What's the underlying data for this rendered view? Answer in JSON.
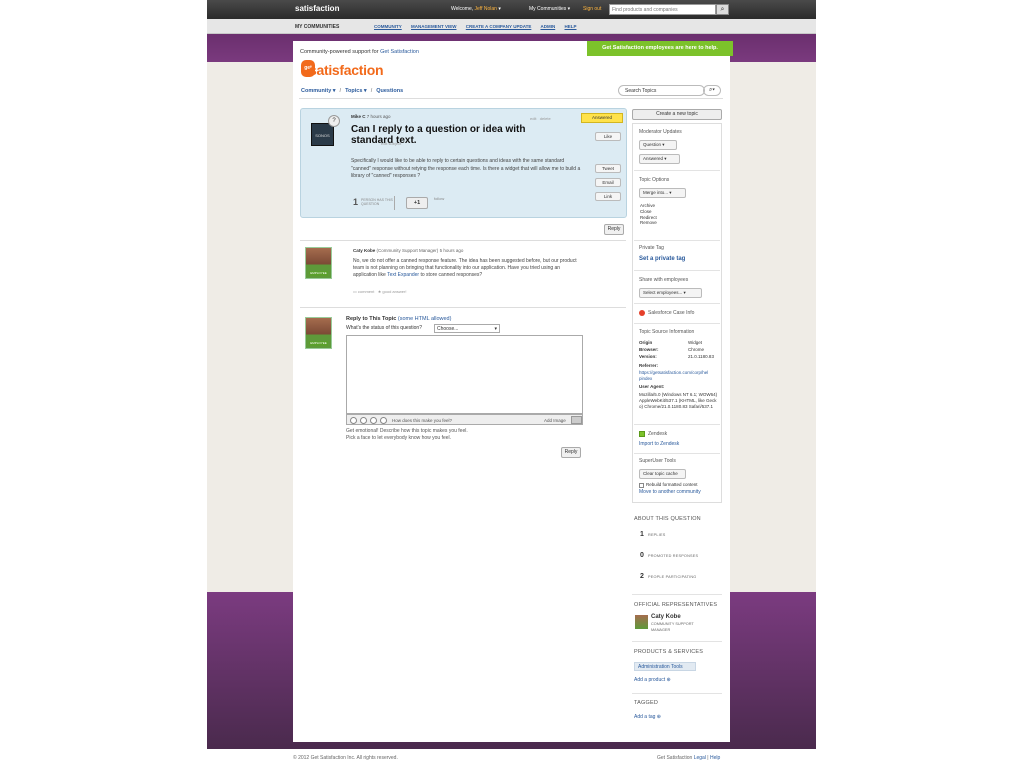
{
  "topbar": {
    "logo": "satisfaction",
    "welcome_prefix": "Welcome,",
    "user": "Jeff Nolan",
    "my_communities": "My Communities",
    "sign_out": "Sign out",
    "search_placeholder": "Find products and companies"
  },
  "subnav": {
    "title": "MY COMMUNITIES",
    "links": [
      "COMMUNITY",
      "MANAGEMENT VIEW",
      "CREATE A COMPANY UPDATE",
      "ADMIN",
      "HELP"
    ]
  },
  "header": {
    "tagline_prefix": "Community-powered support for",
    "tagline_link": "Get Satisfaction",
    "logo_badge": "get",
    "logo_word": "satisfaction",
    "employees_banner": "Get Satisfaction employees are here to help."
  },
  "breadcrumb": [
    "Community",
    "Topics",
    "Questions"
  ],
  "topic_search": {
    "placeholder": "Search Topics"
  },
  "question": {
    "avatar_text": "SONOS",
    "author": "Mike C",
    "time": "7 hours ago",
    "edit": "edit",
    "delete": "delete",
    "title": "Can I reply to a question or idea with standard text.",
    "edit_subject": "edit subject",
    "body": "Specifically I would like to be able to reply to certain questions and ideas with the same standard \"canned\" response without retying the response each time. Is there a widget that will allow me to build a library of \"canned\" responses ?",
    "status": "Answered",
    "like": "Like",
    "tweet": "Tweet",
    "email": "Email",
    "link": "Link",
    "count": "1",
    "count_label": "PERSON HAS THIS QUESTION",
    "plus_one": "+1",
    "follow": "follow"
  },
  "reply_button": "Reply",
  "reply": {
    "author": "Caty Kobe",
    "role": "(Community Support Manager)",
    "time": "5 hours ago",
    "body_pre": "No, we do not offer a canned response feature. The idea has been suggested before, but our product team is not planning on bringing that functionality into our application. Have you tried using an application like",
    "body_link": "Text Expander",
    "body_post": "to store canned responses?",
    "comment": "comment",
    "good_answer": "good answer!",
    "employee_badge": "EMPLOYEE"
  },
  "reply_form": {
    "title": "Reply to This Topic",
    "html_note": "(some HTML allowed)",
    "status_label": "What's the status of this question?",
    "status_value": "Choose...",
    "feel_label": "How does this make you feel?",
    "add_image": "Add Image",
    "help_line1": "Get emotional! Describe how this topic makes you feel.",
    "help_line2": "Pick a face to let everybody know how you feel.",
    "employee_badge": "EMPLOYEE"
  },
  "sidebar": {
    "create_topic": "Create a new topic",
    "moderator_updates": "Moderator Updates",
    "question_btn": "Question",
    "answered_btn": "Answered",
    "topic_options": "Topic Options",
    "merge_btn": "Merge into...",
    "options": [
      "Archive",
      "Close",
      "Redirect",
      "Remove"
    ],
    "private_tag": "Private Tag",
    "set_private_tag": "Set a private tag",
    "share_with_employees": "Share with employees",
    "select_employees": "Select employees...",
    "salesforce": "Salesforce Case Info",
    "source_info": "Topic Source Information",
    "origin_label": "Origin",
    "origin_value": "Widget",
    "browser_label": "Browser:",
    "browser_value": "Chrome",
    "version_label": "Version:",
    "version_value": "21.0.1180.83",
    "referrer_label": "Referrer:",
    "referrer_value": "https://getsatisfaction.com/corp/helpindex",
    "ua_label": "User Agent:",
    "ua_value": "Mozilla/5.0 (Windows NT 6.1; WOW64) AppleWebKit/537.1 (KHTML, like Gecko) Chrome/21.0.1180.83 Safari/537.1",
    "zendesk": "Zendesk",
    "import_zendesk": "Import to Zendesk",
    "superuser": "SuperUser Tools",
    "clear_cache": "Clear topic cache",
    "rebuild": "Rebuild formatted content",
    "move": "Move to another community"
  },
  "about": {
    "title": "ABOUT THIS QUESTION",
    "stats": [
      {
        "n": "1",
        "label": "REPLIES"
      },
      {
        "n": "0",
        "label": "PROMOTED RESPONSES"
      },
      {
        "n": "2",
        "label": "PEOPLE PARTICIPATING"
      }
    ]
  },
  "officials": {
    "title": "OFFICIAL REPRESENTATIVES",
    "name": "Caty Kobe",
    "role": "COMMUNITY SUPPORT MANAGER"
  },
  "products": {
    "title": "PRODUCTS & SERVICES",
    "item": "Administration Tools",
    "add": "Add a product"
  },
  "tagged": {
    "title": "TAGGED",
    "add": "Add a tag"
  },
  "footer": {
    "copyright": "© 2012 Get Satisfaction Inc. All rights reserved.",
    "gs": "Get Satisfaction",
    "legal": "Legal",
    "help": "Help"
  }
}
